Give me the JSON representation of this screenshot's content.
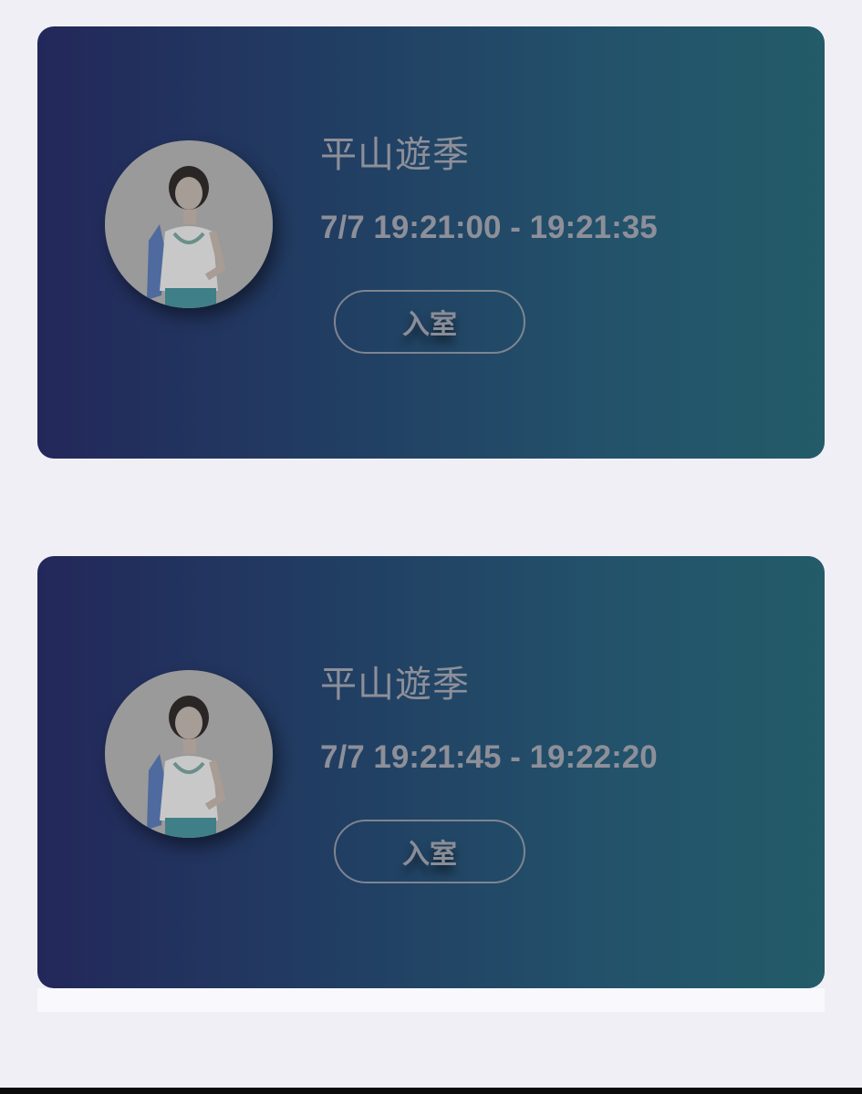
{
  "sessions": [
    {
      "name": "平山遊季",
      "time": "7/7 19:21:00 - 19:21:35",
      "button_label": "入室",
      "avatar_icon": "profile-photo"
    },
    {
      "name": "平山遊季",
      "time": "7/7 19:21:45 - 19:22:20",
      "button_label": "入室",
      "avatar_icon": "profile-photo"
    }
  ],
  "colors": {
    "page_background": "#f0eff5",
    "card_gradient_start": "#23285a",
    "card_gradient_end": "#235b68",
    "text": "#8d8f99"
  }
}
